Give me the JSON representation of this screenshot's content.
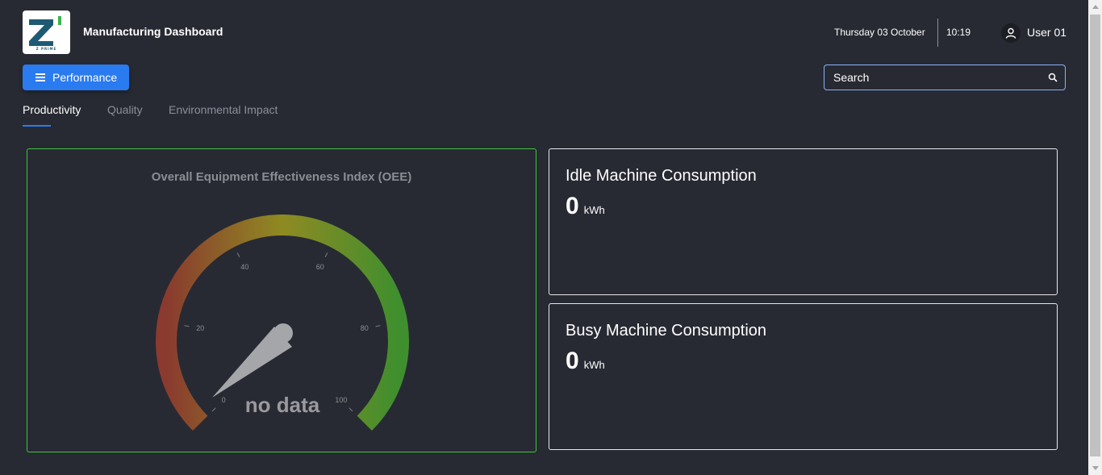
{
  "header": {
    "logo_text": "Z PRIME",
    "title": "Manufacturing Dashboard",
    "date": "Thursday 03 October",
    "time": "10:19",
    "username": "User 01",
    "icons": {
      "user": "user-icon"
    }
  },
  "toolbar": {
    "menu_button_label": "Performance",
    "search_placeholder": "Search",
    "icons": {
      "menu": "hamburger-icon",
      "search": "search-icon"
    }
  },
  "tabs": [
    {
      "label": "Productivity",
      "active": true
    },
    {
      "label": "Quality",
      "active": false
    },
    {
      "label": "Environmental Impact",
      "active": false
    }
  ],
  "oee": {
    "title": "Overall Equipment Effectiveness Index (OEE)",
    "status_text": "no data",
    "gauge": {
      "min": 0,
      "max": 100,
      "ticks": [
        "0",
        "20",
        "40",
        "60",
        "80",
        "100"
      ],
      "value": null,
      "colors": [
        "#8a3a2e",
        "#8f8a22",
        "#3f8f2e"
      ]
    }
  },
  "kpis": [
    {
      "title": "Idle Machine Consumption",
      "value": "0",
      "unit": "kWh"
    },
    {
      "title": "Busy Machine Consumption",
      "value": "0",
      "unit": "kWh"
    }
  ],
  "colors": {
    "background": "#272a33",
    "accent": "#2a7bef",
    "oee_card_border": "#3fc33f",
    "card_border": "#e8e8e8"
  }
}
